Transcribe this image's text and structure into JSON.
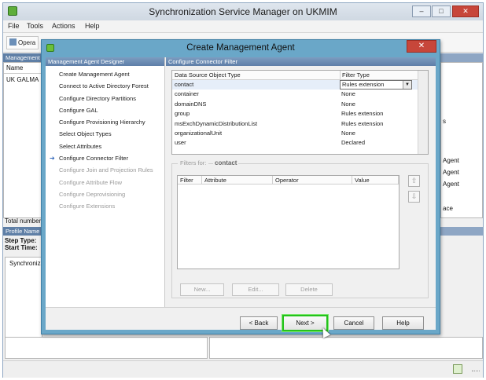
{
  "main_window": {
    "title": "Synchronization Service Manager on UKMIM",
    "menu": [
      "File",
      "Tools",
      "Actions",
      "Help"
    ],
    "toolbar_first_button": "Opera",
    "management_panel_head": "Management",
    "name_column": "Name",
    "agent_row": "UK GALMA",
    "total_label": "Total number",
    "profile_head": "Profile Name",
    "step_type": "Step Type:",
    "start_time": "Start Time:",
    "synch_tab": "Synchroniz",
    "right_snippets": [
      "s",
      "Agent",
      "Agent",
      "Agent",
      "ace"
    ]
  },
  "dialog": {
    "title": "Create Management Agent",
    "side_header": "Management Agent Designer",
    "content_header": "Configure Connector Filter",
    "steps": [
      {
        "label": "Create Management Agent",
        "state": "normal"
      },
      {
        "label": "Connect to Active Directory Forest",
        "state": "normal"
      },
      {
        "label": "Configure Directory Partitions",
        "state": "normal"
      },
      {
        "label": "Configure GAL",
        "state": "normal"
      },
      {
        "label": "Configure Provisioning Hierarchy",
        "state": "normal"
      },
      {
        "label": "Select Object Types",
        "state": "normal"
      },
      {
        "label": "Select Attributes",
        "state": "normal"
      },
      {
        "label": "Configure Connector Filter",
        "state": "current"
      },
      {
        "label": "Configure Join and Projection Rules",
        "state": "disabled"
      },
      {
        "label": "Configure Attribute Flow",
        "state": "disabled"
      },
      {
        "label": "Configure Deprovisioning",
        "state": "disabled"
      },
      {
        "label": "Configure Extensions",
        "state": "disabled"
      }
    ],
    "object_table": {
      "columns": [
        "Data Source Object Type",
        "Filter Type"
      ],
      "rows": [
        {
          "type": "contact",
          "filter": "Rules extension"
        },
        {
          "type": "container",
          "filter": "None"
        },
        {
          "type": "domainDNS",
          "filter": "None"
        },
        {
          "type": "group",
          "filter": "Rules extension"
        },
        {
          "type": "msExchDynamicDistributionList",
          "filter": "Rules extension"
        },
        {
          "type": "organizationalUnit",
          "filter": "None"
        },
        {
          "type": "user",
          "filter": "Declared"
        }
      ],
      "selected_row": 0
    },
    "filters": {
      "label": "Filters for:",
      "object": "contact",
      "columns": [
        "Filter",
        "Attribute",
        "Operator",
        "Value"
      ],
      "buttons": {
        "new": "New...",
        "edit": "Edit...",
        "delete": "Delete"
      }
    },
    "buttons": {
      "back": "< Back",
      "next": "Next >",
      "cancel": "Cancel",
      "help": "Help"
    },
    "highlight_color": "#25c21c"
  }
}
